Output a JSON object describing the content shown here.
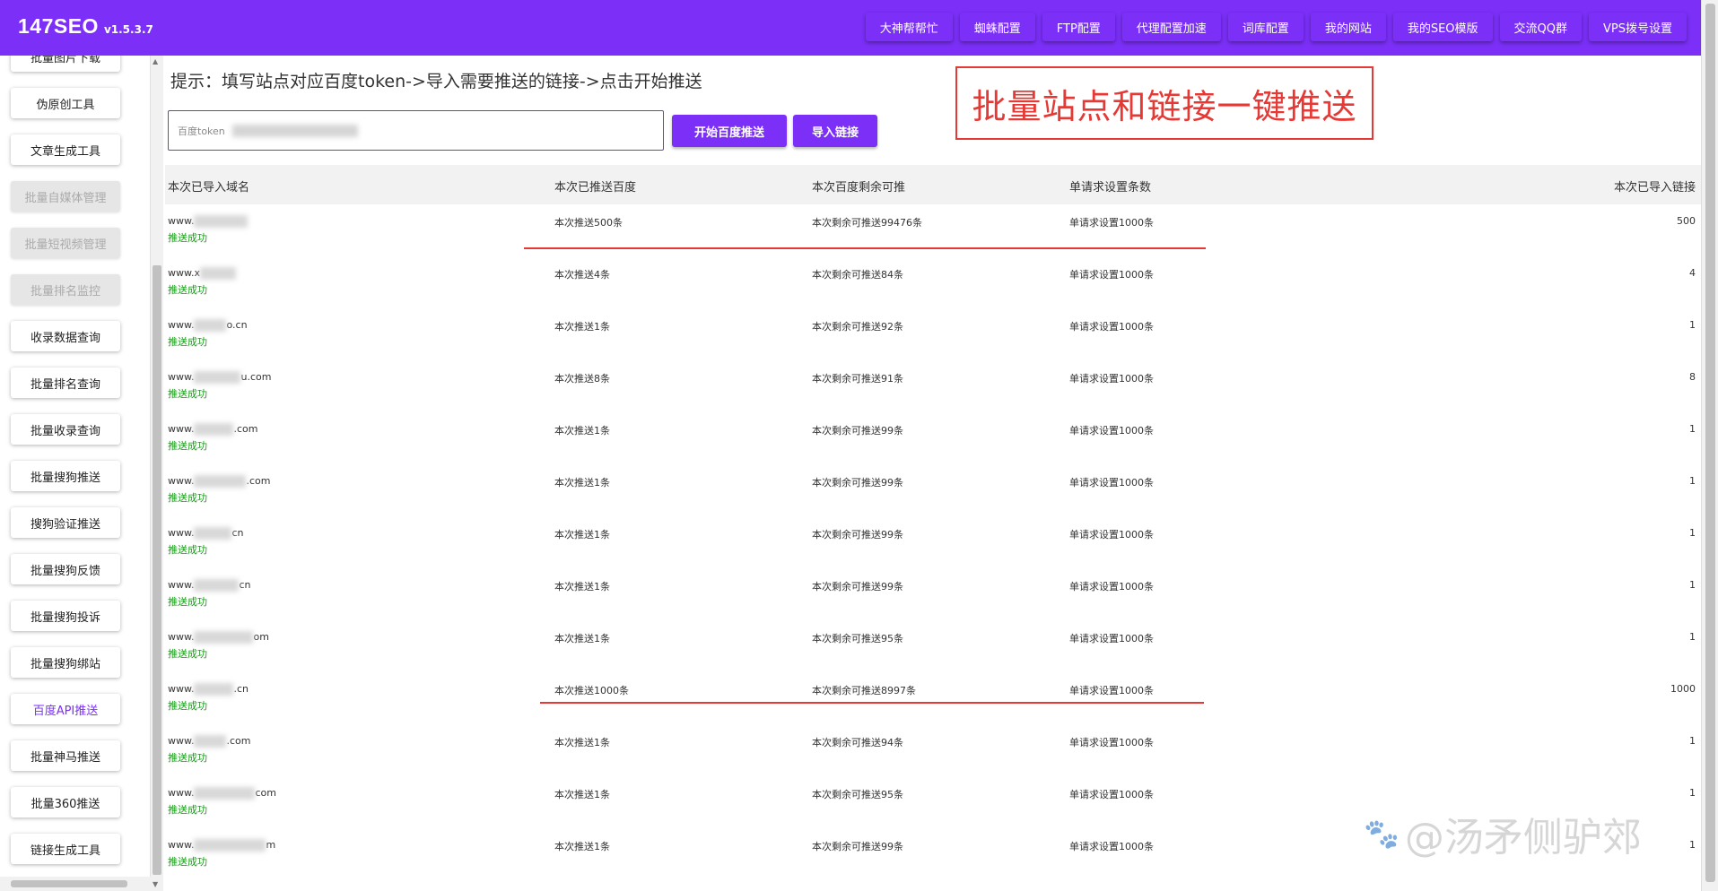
{
  "app": {
    "name": "147SEO",
    "version": "v1.5.3.7"
  },
  "nav": [
    "大神帮帮忙",
    "蜘蛛配置",
    "FTP配置",
    "代理配置加速",
    "词库配置",
    "我的网站",
    "我的SEO模版",
    "交流QQ群",
    "VPS拨号设置"
  ],
  "sidebar": [
    {
      "label": "批量图片下载",
      "state": "normal"
    },
    {
      "label": "伪原创工具",
      "state": "normal"
    },
    {
      "label": "文章生成工具",
      "state": "normal"
    },
    {
      "label": "批量自媒体管理",
      "state": "disabled"
    },
    {
      "label": "批量短视频管理",
      "state": "disabled"
    },
    {
      "label": "批量排名监控",
      "state": "disabled"
    },
    {
      "label": "收录数据查询",
      "state": "normal"
    },
    {
      "label": "批量排名查询",
      "state": "normal"
    },
    {
      "label": "批量收录查询",
      "state": "normal"
    },
    {
      "label": "批量搜狗推送",
      "state": "normal"
    },
    {
      "label": "搜狗验证推送",
      "state": "normal"
    },
    {
      "label": "批量搜狗反馈",
      "state": "normal"
    },
    {
      "label": "批量搜狗投诉",
      "state": "normal"
    },
    {
      "label": "批量搜狗绑站",
      "state": "normal"
    },
    {
      "label": "百度API推送",
      "state": "active"
    },
    {
      "label": "批量神马推送",
      "state": "normal"
    },
    {
      "label": "批量360推送",
      "state": "normal"
    },
    {
      "label": "链接生成工具",
      "state": "normal"
    }
  ],
  "main": {
    "hint": "提示：填写站点对应百度token->导入需要推送的链接->点击开始推送",
    "token_placeholder": "百度token",
    "start_button": "开始百度推送",
    "import_button": "导入链接",
    "callout": "批量站点和链接一键推送"
  },
  "table": {
    "headers": [
      "本次已导入域名",
      "本次已推送百度",
      "本次百度剩余可推",
      "单请求设置条数",
      "本次已导入链接"
    ],
    "rows": [
      {
        "domain_prefix": "www.",
        "domain_suffix": "",
        "status": "推送成功",
        "pushed": "本次推送500条",
        "remaining": "本次剩余可推送99476条",
        "per_request": "单请求设置1000条",
        "links": "500"
      },
      {
        "domain_prefix": "www.x",
        "domain_suffix": "",
        "status": "推送成功",
        "pushed": "本次推送4条",
        "remaining": "本次剩余可推送84条",
        "per_request": "单请求设置1000条",
        "links": "4"
      },
      {
        "domain_prefix": "www.",
        "domain_suffix": "o.cn",
        "status": "推送成功",
        "pushed": "本次推送1条",
        "remaining": "本次剩余可推送92条",
        "per_request": "单请求设置1000条",
        "links": "1"
      },
      {
        "domain_prefix": "www.",
        "domain_suffix": "u.com",
        "status": "推送成功",
        "pushed": "本次推送8条",
        "remaining": "本次剩余可推送91条",
        "per_request": "单请求设置1000条",
        "links": "8"
      },
      {
        "domain_prefix": "www.",
        "domain_suffix": ".com",
        "status": "推送成功",
        "pushed": "本次推送1条",
        "remaining": "本次剩余可推送99条",
        "per_request": "单请求设置1000条",
        "links": "1"
      },
      {
        "domain_prefix": "www.",
        "domain_suffix": ".com",
        "status": "推送成功",
        "pushed": "本次推送1条",
        "remaining": "本次剩余可推送99条",
        "per_request": "单请求设置1000条",
        "links": "1"
      },
      {
        "domain_prefix": "www.",
        "domain_suffix": "cn",
        "status": "推送成功",
        "pushed": "本次推送1条",
        "remaining": "本次剩余可推送99条",
        "per_request": "单请求设置1000条",
        "links": "1"
      },
      {
        "domain_prefix": "www.",
        "domain_suffix": "cn",
        "status": "推送成功",
        "pushed": "本次推送1条",
        "remaining": "本次剩余可推送99条",
        "per_request": "单请求设置1000条",
        "links": "1"
      },
      {
        "domain_prefix": "www.",
        "domain_suffix": "om",
        "status": "推送成功",
        "pushed": "本次推送1条",
        "remaining": "本次剩余可推送95条",
        "per_request": "单请求设置1000条",
        "links": "1"
      },
      {
        "domain_prefix": "www.",
        "domain_suffix": ".cn",
        "status": "推送成功",
        "pushed": "本次推送1000条",
        "remaining": "本次剩余可推送8997条",
        "per_request": "单请求设置1000条",
        "links": "1000"
      },
      {
        "domain_prefix": "www.",
        "domain_suffix": ".com",
        "status": "推送成功",
        "pushed": "本次推送1条",
        "remaining": "本次剩余可推送94条",
        "per_request": "单请求设置1000条",
        "links": "1"
      },
      {
        "domain_prefix": "www.",
        "domain_suffix": "com",
        "status": "推送成功",
        "pushed": "本次推送1条",
        "remaining": "本次剩余可推送95条",
        "per_request": "单请求设置1000条",
        "links": "1"
      },
      {
        "domain_prefix": "www.",
        "domain_suffix": "m",
        "status": "推送成功",
        "pushed": "本次推送1条",
        "remaining": "本次剩余可推送99条",
        "per_request": "单请求设置1000条",
        "links": "1"
      }
    ]
  },
  "watermark": "@汤矛侧驴郊",
  "colors": {
    "accent": "#7b2ff7",
    "annotation_red": "#e53935",
    "success_green": "#1a9b1a"
  }
}
